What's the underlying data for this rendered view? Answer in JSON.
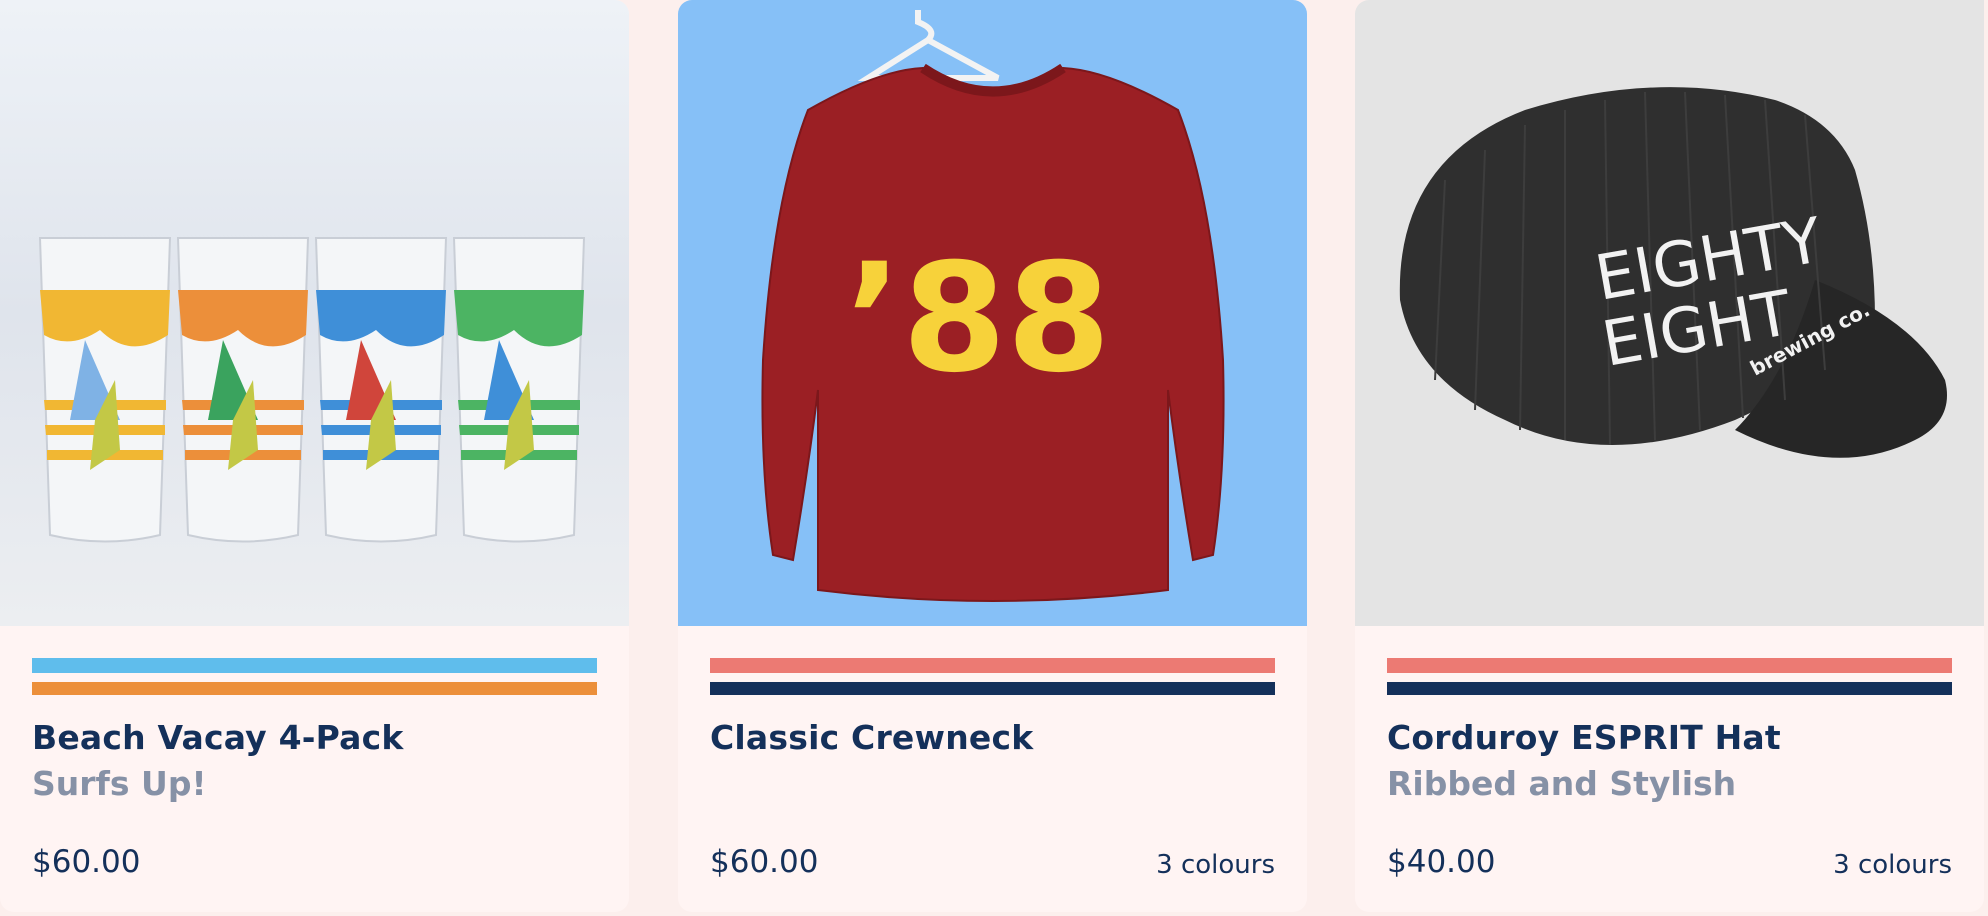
{
  "products": [
    {
      "title": "Beach Vacay 4-Pack",
      "subtitle": "Surfs Up!",
      "price": "$60.00",
      "colours": "",
      "stripe_colors": [
        "#5fbdec",
        "#ec8f3a"
      ],
      "image": "beer-glasses-4-pack"
    },
    {
      "title": "Classic Crewneck",
      "subtitle": "",
      "price": "$60.00",
      "colours": "3 colours",
      "stripe_colors": [
        "#ec7a73",
        "#14305a"
      ],
      "image": "red-crewneck-sweatshirt",
      "logo_text": "’88"
    },
    {
      "title": "Corduroy ESPRIT Hat",
      "subtitle": "Ribbed and Stylish",
      "price": "$40.00",
      "colours": "3 colours",
      "stripe_colors": [
        "#ec7a73",
        "#14305a"
      ],
      "image": "black-corduroy-cap",
      "logo_text": [
        "EIGHTY",
        "EIGHT",
        "brewing co."
      ]
    }
  ]
}
